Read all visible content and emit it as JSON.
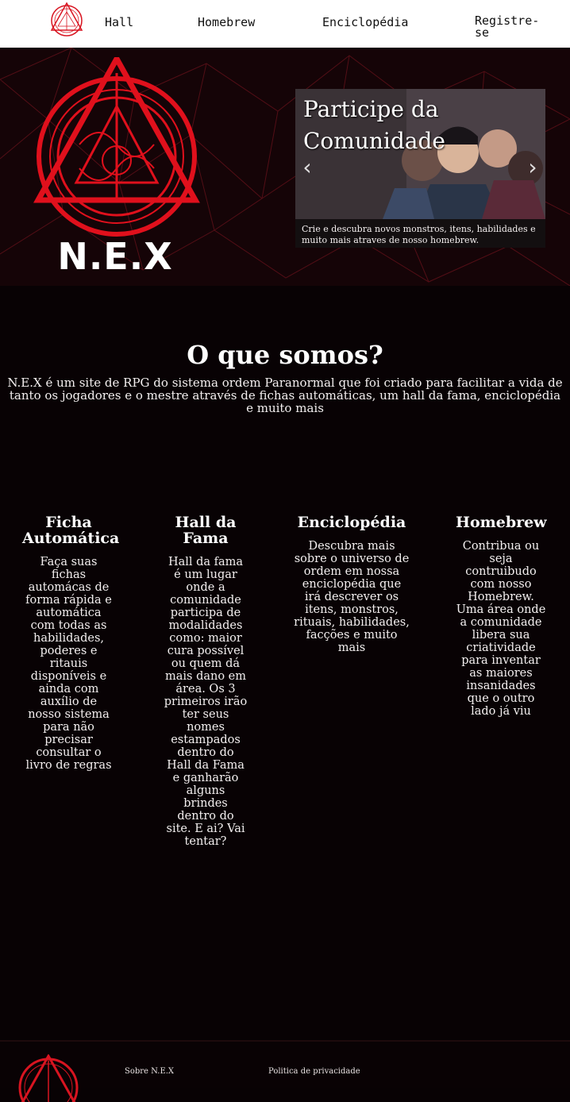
{
  "nav": {
    "links": [
      {
        "label": "Hall"
      },
      {
        "label": "Homebrew"
      },
      {
        "label": "Enciclopédia"
      },
      {
        "label": "Registre-se"
      }
    ]
  },
  "hero": {
    "site_name": "N.E.X",
    "banner": {
      "title_line1": "Participe da",
      "title_line2": "Comunidade",
      "caption": "Crie e descubra novos monstros, itens, habilidades e muito mais atraves de nosso homebrew.",
      "prev_icon": "chevron-left-icon",
      "next_icon": "chevron-right-icon"
    }
  },
  "about": {
    "title": "O que somos?",
    "text": "N.E.X é um site de RPG do sistema ordem Paranormal que foi criado para facilitar a vida de tanto os jogadores e o mestre através de fichas automáticas, um hall da fama, enciclopédia e muito mais"
  },
  "features": [
    {
      "title": "Ficha Automática",
      "text": "Faça suas fichas automácas de forma rápida e automática com todas as habilidades, poderes e ritauis disponíveis e ainda com auxílio de nosso sistema para não precisar consultar o livro de regras"
    },
    {
      "title": "Hall da Fama",
      "text": "Hall da fama é um lugar onde a comunidade participa de modalidades como: maior cura possível ou quem dá mais dano em área. Os 3 primeiros irão ter seus nomes estampados dentro do Hall da Fama e ganharão alguns brindes dentro do site. E ai? Vai tentar?"
    },
    {
      "title": "Enciclopédia",
      "text": "Descubra mais sobre o universo de ordem em nossa enciclopédia que irá descrever os itens, monstros, rituais, habilidades, facções e muito mais"
    },
    {
      "title": "Homebrew",
      "text": "Contribua ou seja contruibudo com nosso Homebrew. Uma área onde a comunidade libera sua criatividade para inventar as maiores insanidades que o outro lado já viu"
    }
  ],
  "footer": {
    "about_link": "Sobre N.E.X",
    "privacy_link": "Politica de privacidade"
  },
  "colors": {
    "accent": "#e0101c",
    "background": "#080204",
    "nav_bg": "#ffffff"
  }
}
